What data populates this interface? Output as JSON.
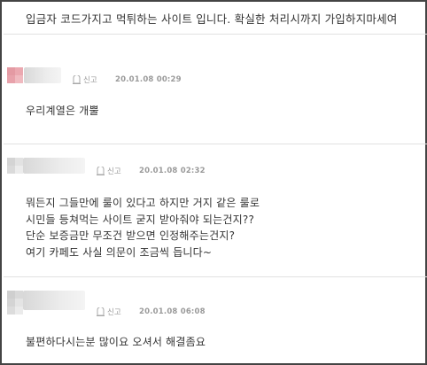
{
  "post": {
    "text": "입금자 코드가지고 먹튀하는 사이트 입니다. 확실한 처리시까지 가입하지마세여"
  },
  "comments": [
    {
      "report_label": "신고",
      "date": "20.01.08 00:29",
      "lines": [
        "우리계열은 개뿔"
      ],
      "accent": "#e8a0a8"
    },
    {
      "report_label": "신고",
      "date": "20.01.08 02:32",
      "lines": [
        "뭐든지 그들만에 룰이 있다고 하지만 거지 같은 룰로",
        "시민들 등쳐먹는 사이트 굳지 받아줘야 되는건지??",
        "단순 보증금만 무조건 받으면 인정해주는건지?",
        "여기 카페도 사실 의문이 조금씩 듭니다~"
      ],
      "accent": "#cfcfcf"
    },
    {
      "report_label": "신고",
      "date": "20.01.08 06:08",
      "lines": [
        "불편하다시는분 많이요 오셔서 해결좀요"
      ],
      "accent": "#c8c8c8"
    }
  ]
}
